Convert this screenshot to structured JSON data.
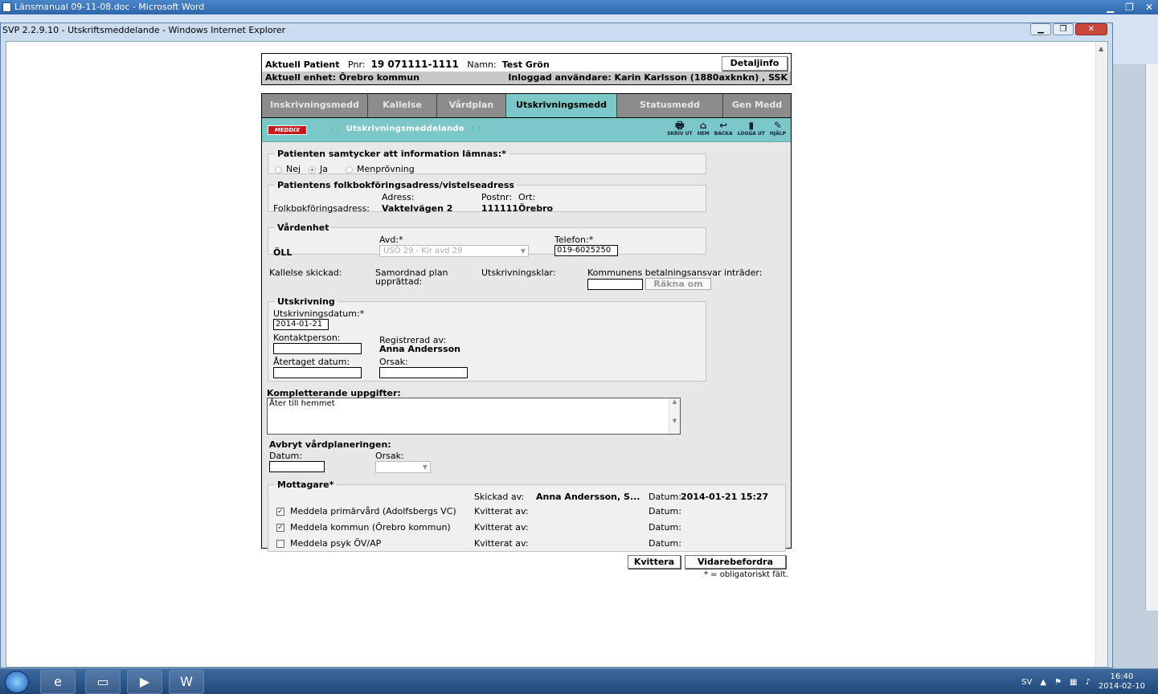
{
  "word": {
    "title": "Länsmanual 09-11-08.doc - Microsoft Word"
  },
  "ie": {
    "title": "SVP 2.2.9.10 - Utskriftsmeddelande - Windows Internet Explorer"
  },
  "patient": {
    "label": "Aktuell Patient",
    "pnr_label": "Pnr:",
    "pnr": "19 071111-1111",
    "namn_label": "Namn:",
    "namn": "Test Grön",
    "detaljinfo": "Detaljinfo",
    "enhet": "Aktuell enhet: Örebro kommun",
    "user": "Inloggad användare: Karin Karlsson (1880axknkn) , SSK"
  },
  "tabs": [
    "Inskrivningsmedd",
    "Kallelse",
    "Vårdplan",
    "Utskrivningsmedd",
    "Statusmedd",
    "Gen Medd"
  ],
  "toolbar": {
    "logo": "MEDDIX",
    "title": "Utskrivningsmeddelande",
    "tools": [
      {
        "icon": "printer-icon",
        "label": "SKRIV UT",
        "glyph": "🖶"
      },
      {
        "icon": "home-icon",
        "label": "HEM",
        "glyph": "⌂"
      },
      {
        "icon": "back-icon",
        "label": "BACKA",
        "glyph": "↩"
      },
      {
        "icon": "logout-icon",
        "label": "LOGGA UT",
        "glyph": "▮"
      },
      {
        "icon": "help-icon",
        "label": "HJÄLP",
        "glyph": "✎"
      }
    ]
  },
  "samtycke": {
    "legend": "Patienten samtycker att information lämnas:*",
    "options": [
      "Nej",
      "Ja",
      "Menprövning"
    ]
  },
  "adress": {
    "legend": "Patientens folkbokföringsadress/vistelseadress",
    "adress_label": "Adress:",
    "postnr_label": "Postnr:",
    "ort_label": "Ort:",
    "folk_label": "Folkbokföringsadress:",
    "adress": "Vaktelvägen 2",
    "postnr": "111111",
    "ort": "Örebro"
  },
  "vardenhet": {
    "legend": "Vårdenhet",
    "name": "ÖLL",
    "avd_label": "Avd:*",
    "avd_value": "USÖ 29 - Kir avd 29",
    "tel_label": "Telefon:*",
    "tel_value": "019-6025250"
  },
  "status": {
    "kallelse": "Kallelse skickad:",
    "samordnad1": "Samordnad plan",
    "samordnad2": "upprättad:",
    "klar": "Utskrivningsklar:",
    "betalning": "Kommunens betalningsansvar inträder:",
    "rakna": "Räkna om"
  },
  "utskrivning": {
    "legend": "Utskrivning",
    "datum_label": "Utskrivningsdatum:*",
    "datum_value": "2014-01-21",
    "kontakt_label": "Kontaktperson:",
    "reg_label": "Registrerad av:",
    "reg_value": "Anna Andersson",
    "ater_label": "Återtaget datum:",
    "orsak_label": "Orsak:"
  },
  "komplett": {
    "label": "Kompletterande uppgifter:",
    "value": "Åter till hemmet"
  },
  "avbryt": {
    "label": "Avbryt vårdplaneringen:",
    "datum_label": "Datum:",
    "orsak_label": "Orsak:"
  },
  "mottagare": {
    "legend": "Mottagare*",
    "skickad_label": "Skickad av:",
    "skickad_value": "Anna Andersson, S...",
    "datum_label": "Datum:",
    "skickad_datum": "2014-01-21 15:27",
    "kvitt_label": "Kvitterat av:",
    "rows": [
      {
        "label": "Meddela primärvård (Adolfsbergs VC)",
        "checked": true
      },
      {
        "label": "Meddela kommun (Örebro kommun)",
        "checked": true
      },
      {
        "label": "Meddela psyk ÖV/AP",
        "checked": false
      }
    ]
  },
  "buttons": {
    "kvittera": "Kvittera",
    "vidare": "Vidarebefordra"
  },
  "note": "* = obligatoriskt fält.",
  "tray": {
    "lang": "SV",
    "time": "16:40",
    "date": "2014-02-10"
  }
}
